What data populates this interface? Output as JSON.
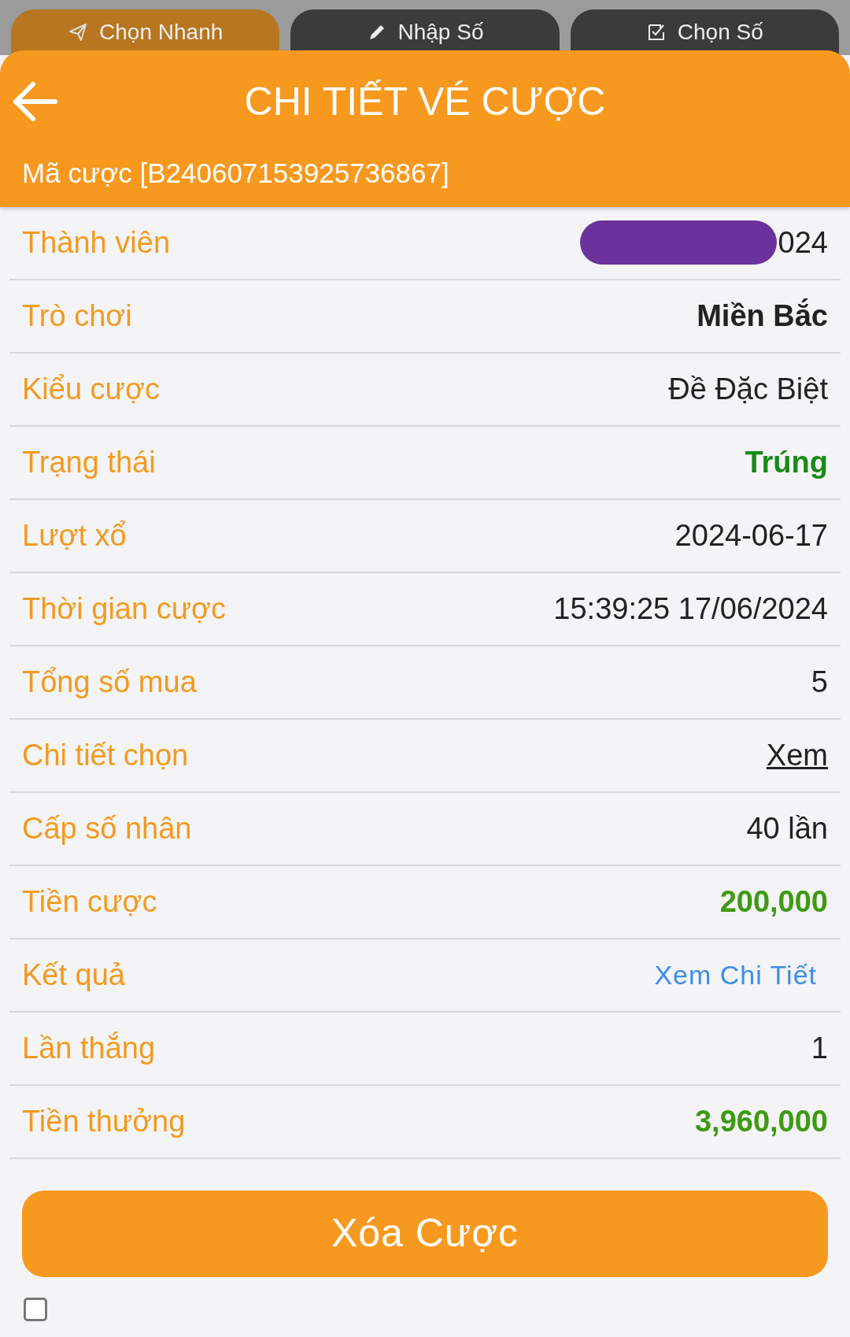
{
  "tabs": [
    {
      "label": "Chọn Nhanh",
      "kind": "send",
      "selected": true
    },
    {
      "label": "Nhập Số",
      "kind": "pencil",
      "selected": false
    },
    {
      "label": "Chọn Số",
      "kind": "check",
      "selected": false
    }
  ],
  "dialog": {
    "title": "CHI TIẾT VÉ CƯỢC",
    "subtitle": "Mã cược [B240607153925736867]"
  },
  "rows": [
    {
      "label": "Thành viên",
      "value": "024",
      "kind": "masked"
    },
    {
      "label": "Trò chơi",
      "value": "Miền Bắc",
      "kind": "bold"
    },
    {
      "label": "Kiểu cược",
      "value": "Đề Đặc Biệt",
      "kind": "plain"
    },
    {
      "label": "Trạng thái",
      "value": "Trúng",
      "kind": "win"
    },
    {
      "label": "Lượt xổ",
      "value": "2024-06-17",
      "kind": "plain"
    },
    {
      "label": "Thời gian cược",
      "value": "15:39:25 17/06/2024",
      "kind": "plain"
    },
    {
      "label": "Tổng số mua",
      "value": "5",
      "kind": "plain"
    },
    {
      "label": "Chi tiết chọn",
      "value": "Xem",
      "kind": "link"
    },
    {
      "label": "Cấp số nhân",
      "value": "40 lần",
      "kind": "plain"
    },
    {
      "label": "Tiền cược",
      "value": "200,000",
      "kind": "money"
    },
    {
      "label": "Kết quả",
      "value": "Xem Chi Tiết",
      "kind": "detail"
    },
    {
      "label": "Lần thắng",
      "value": "1",
      "kind": "plain"
    },
    {
      "label": "Tiền thưởng",
      "value": "3,960,000",
      "kind": "money"
    }
  ],
  "delete_button": "Xóa Cược",
  "agree_checkbox": {
    "checked": false
  }
}
